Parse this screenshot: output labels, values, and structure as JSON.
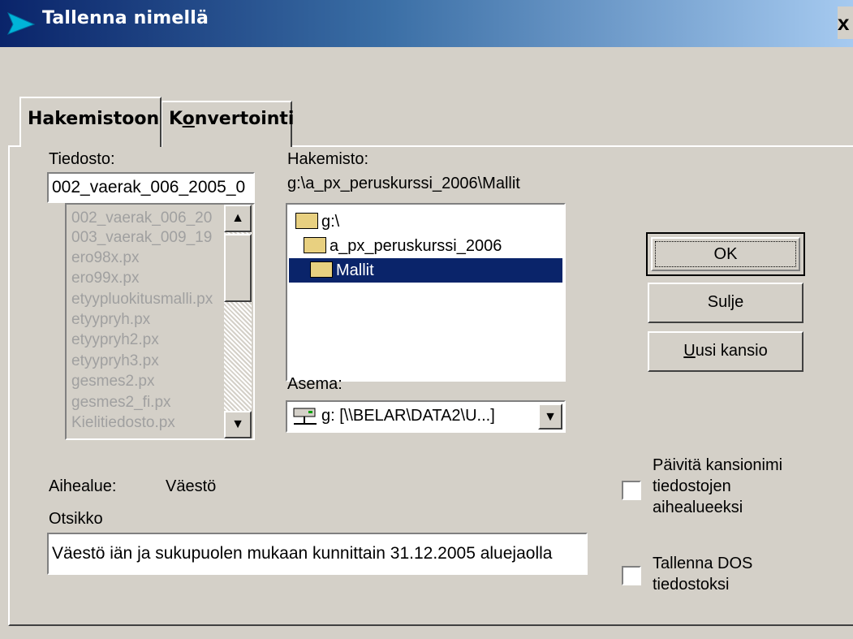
{
  "window": {
    "title": "Tallenna nimellä",
    "close_label": "x"
  },
  "tabs": [
    {
      "label": "Hakemistoon",
      "active": true
    },
    {
      "label_prefix": "K",
      "label_mnemonic": "o",
      "label_rest": "nvertointi",
      "active": false
    }
  ],
  "file": {
    "label": "Tiedosto:",
    "value": "002_vaerak_006_2005_0",
    "items": [
      "002_vaerak_006_20",
      "003_vaerak_009_19",
      "ero98x.px",
      "ero99x.px",
      "etyypluokitusmalli.px",
      "etyypryh.px",
      "etyypryh2.px",
      "etyypryh3.px",
      "gesmes2.px",
      "gesmes2_fi.px",
      "Kielitiedosto.px"
    ]
  },
  "directory": {
    "label": "Hakemisto:",
    "path": "g:\\a_px_peruskurssi_2006\\Mallit",
    "tree": [
      {
        "label": "g:\\",
        "selected": false
      },
      {
        "label": "a_px_peruskurssi_2006",
        "selected": false
      },
      {
        "label": "Mallit",
        "selected": true
      }
    ]
  },
  "drive": {
    "label": "Asema:",
    "value": "g: [\\\\BELAR\\DATA2\\U...]"
  },
  "buttons": {
    "ok": "OK",
    "close": "Sulje",
    "new_folder_mnemonic": "U",
    "new_folder_rest": "usi kansio"
  },
  "subject": {
    "label": "Aihealue:",
    "value": "Väestö"
  },
  "heading": {
    "label": "Otsikko",
    "value": "Väestö iän ja sukupuolen mukaan kunnittain 31.12.2005 aluejaolla"
  },
  "options": {
    "update_folder": [
      "Päivitä kansionimi",
      "tiedostojen",
      "aihealueeksi"
    ],
    "save_dos": [
      "Tallenna DOS",
      "tiedostoksi"
    ]
  },
  "colors": {
    "selection": "#0a246a",
    "face": "#d4d0c8"
  }
}
